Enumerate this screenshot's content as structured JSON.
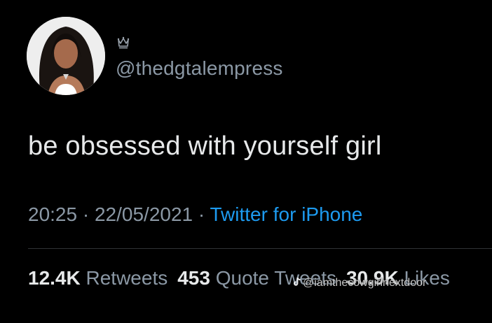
{
  "tweet": {
    "handle": "@thedgtalempress",
    "text": "be obsessed with yourself girl",
    "time": "20:25",
    "separator": " · ",
    "date": "22/05/2021",
    "source": "Twitter for iPhone",
    "icons": {
      "badge": "crown-icon",
      "avatar": "profile-avatar"
    }
  },
  "stats": {
    "retweets_count": "12.4K",
    "retweets_label": "Retweets",
    "quote_count": "453",
    "quote_label": "Quote Tweets",
    "likes_count": "30.9K",
    "likes_label": "Likes"
  },
  "watermark": {
    "text": "@iamthecowgirlnextdoor",
    "icon": "tiktok-icon"
  },
  "colors": {
    "background": "#000000",
    "primary_text": "#e7e9ea",
    "secondary_text": "#8b98a5",
    "link": "#1d9bf0",
    "divider": "#2f3336"
  }
}
